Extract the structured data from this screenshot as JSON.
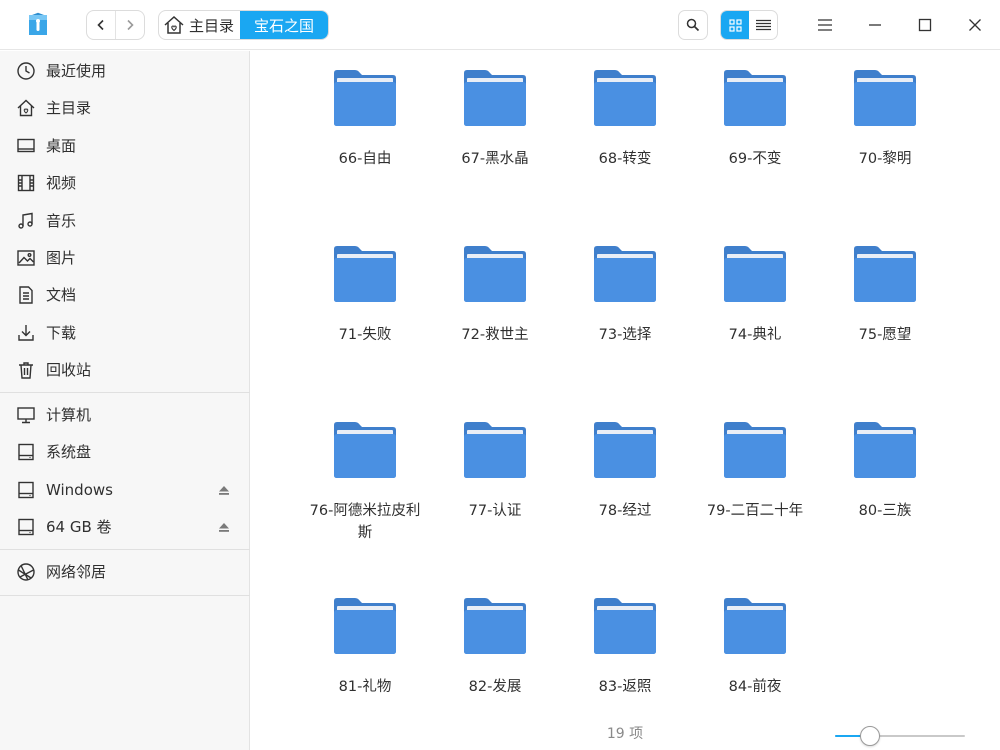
{
  "titlebar": {
    "breadcrumb": {
      "home_label": "主目录",
      "current_label": "宝石之国"
    }
  },
  "sidebar": {
    "groups": [
      [
        {
          "label": "最近使用",
          "icon": "clock-icon"
        },
        {
          "label": "主目录",
          "icon": "home-icon"
        },
        {
          "label": "桌面",
          "icon": "desktop-icon"
        },
        {
          "label": "视频",
          "icon": "video-icon"
        },
        {
          "label": "音乐",
          "icon": "music-icon"
        },
        {
          "label": "图片",
          "icon": "picture-icon"
        },
        {
          "label": "文档",
          "icon": "document-icon"
        },
        {
          "label": "下载",
          "icon": "download-icon"
        },
        {
          "label": "回收站",
          "icon": "trash-icon"
        }
      ],
      [
        {
          "label": "计算机",
          "icon": "computer-icon"
        },
        {
          "label": "系统盘",
          "icon": "disk-icon"
        },
        {
          "label": "Windows",
          "icon": "disk-icon",
          "eject": true
        },
        {
          "label": "64 GB 卷",
          "icon": "disk-icon",
          "eject": true
        }
      ],
      [
        {
          "label": "网络邻居",
          "icon": "network-icon"
        }
      ]
    ]
  },
  "files": [
    "66-自由",
    "67-黑水晶",
    "68-转变",
    "69-不变",
    "70-黎明",
    "71-失败",
    "72-救世主",
    "73-选择",
    "74-典礼",
    "75-愿望",
    "76-阿德米拉皮利斯",
    "77-认证",
    "78-经过",
    "79-二百二十年",
    "80-三族",
    "81-礼物",
    "82-发展",
    "83-返照",
    "84-前夜"
  ],
  "statusbar": {
    "count_label": "19 项",
    "zoom_fraction": 0.27
  },
  "colors": {
    "accent": "#1aa7f2",
    "folder_body": "#4a90e2",
    "folder_tab": "#3f7fcc"
  }
}
